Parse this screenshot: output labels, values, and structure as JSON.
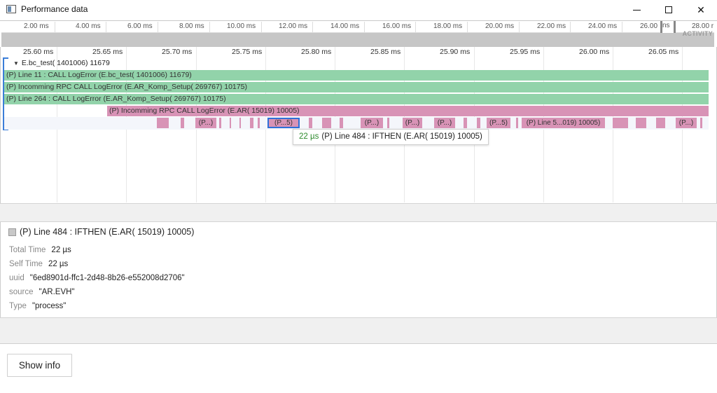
{
  "window": {
    "title": "Performance data",
    "controls": {
      "minimize": "minimize-icon",
      "maximize": "maximize-icon",
      "close": "close-icon"
    }
  },
  "overview": {
    "ticks": [
      "2.00 ms",
      "4.00 ms",
      "6.00 ms",
      "8.00 ms",
      "10.00 ms",
      "12.00 ms",
      "14.00 ms",
      "16.00 ms",
      "18.00 ms",
      "20.00 ms",
      "22.00 ms",
      "24.00 ms",
      "26.00",
      "28.00 r"
    ],
    "window_label": "ns",
    "activity_label": "ACTIVITY"
  },
  "flame": {
    "ticks": [
      "25.60 ms",
      "25.65 ms",
      "25.70 ms",
      "25.75 ms",
      "25.80 ms",
      "25.85 ms",
      "25.90 ms",
      "25.95 ms",
      "26.00 ms",
      "26.05 ms"
    ],
    "track_header": "E.bc_test( 1401006) 11679",
    "rows": [
      "(P) Line  11 : CALL LogError (E.bc_test( 1401006) 11679)",
      "(P) Incomming RPC CALL LogError (E.AR_Komp_Setup( 269767) 10175)",
      "(P) Line  264 : CALL LogError (E.AR_Komp_Setup( 269767) 10175)",
      "(P) Incomming RPC CALL LogError (E.AR( 15019) 10005)"
    ],
    "blocks": [
      "(P...)",
      "(P...5)",
      "(P...)",
      "(P...)",
      "(P...)",
      "(P...5)",
      "(P) Line  5...019) 10005)",
      "(P...)"
    ],
    "colors": {
      "call_bar": "#92d3aa",
      "rpc_bar": "#d893b6",
      "selection": "#2f6fd8"
    }
  },
  "tooltip": {
    "duration": "22 µs",
    "text": "(P) Line 484 : IFTHEN (E.AR( 15019) 10005)"
  },
  "details": {
    "title": "(P) Line 484 : IFTHEN (E.AR( 15019) 10005)",
    "properties": [
      {
        "key": "Total Time",
        "value": "22 µs"
      },
      {
        "key": "Self Time",
        "value": "22 µs"
      },
      {
        "key": "uuid",
        "value": "\"6ed8901d-ffc1-2d48-8b26-e552008d2706\""
      },
      {
        "key": "source",
        "value": "\"AR.EVH\""
      },
      {
        "key": "Type",
        "value": "\"process\""
      }
    ]
  },
  "footer": {
    "show_info_label": "Show info"
  }
}
